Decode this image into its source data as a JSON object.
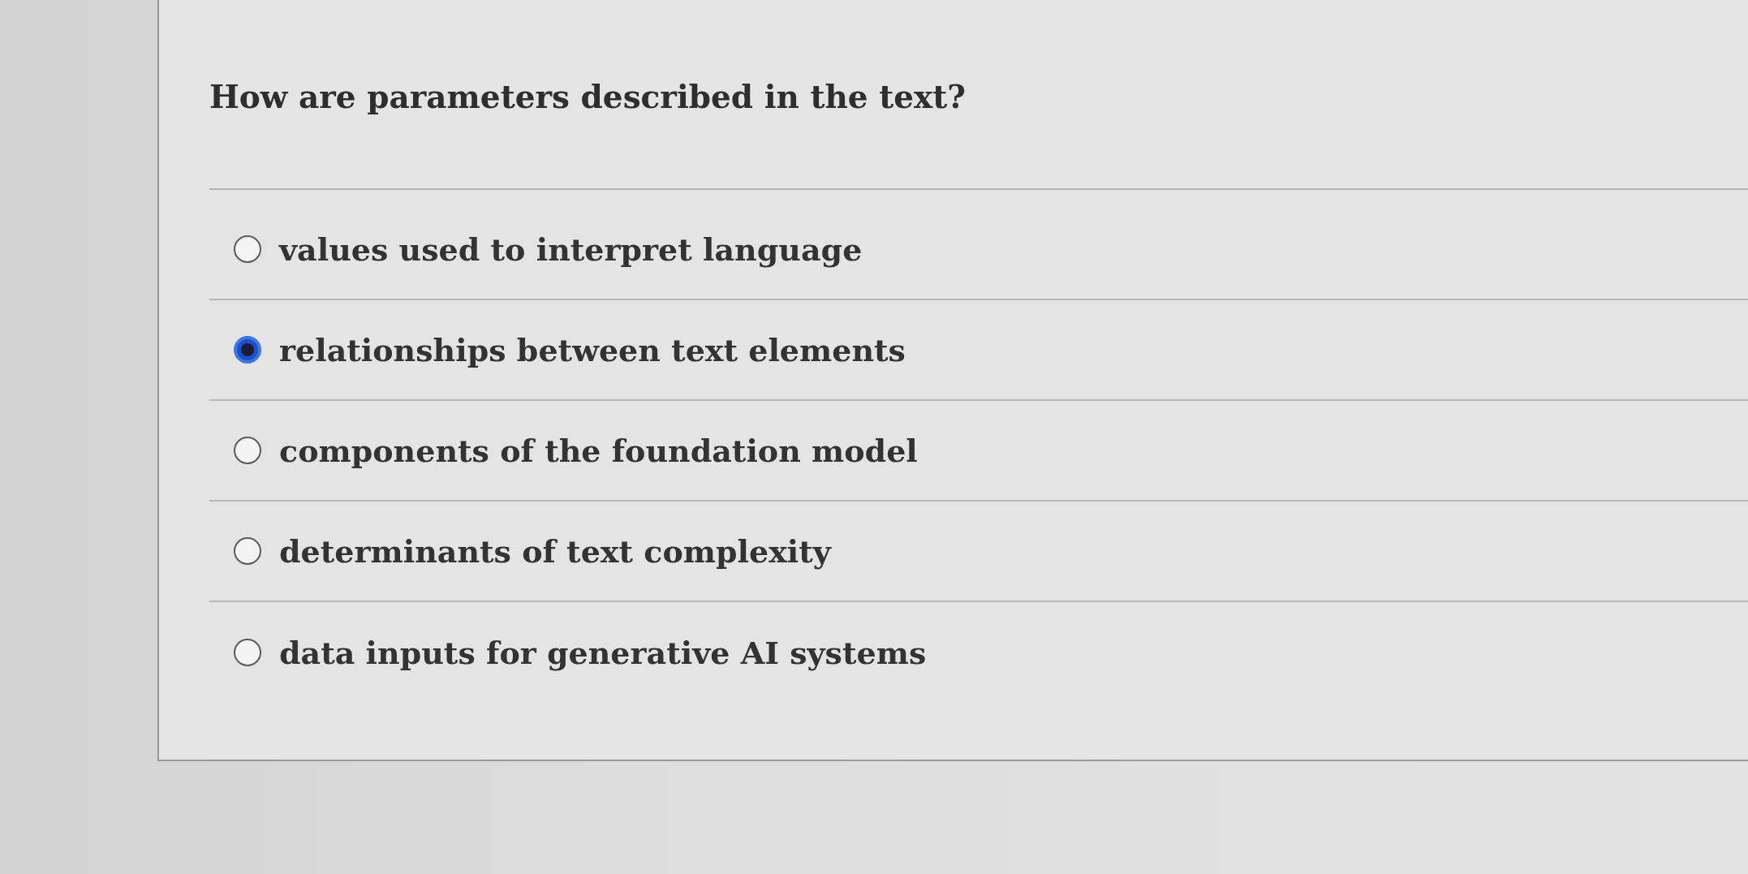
{
  "question": {
    "text": "How are parameters described in the text?"
  },
  "options": [
    {
      "label": "values used to interpret language",
      "selected": false
    },
    {
      "label": "relationships between text elements",
      "selected": true
    },
    {
      "label": "components of the foundation model",
      "selected": false
    },
    {
      "label": "determinants of text complexity",
      "selected": false
    },
    {
      "label": "data inputs for generative AI systems",
      "selected": false
    }
  ]
}
